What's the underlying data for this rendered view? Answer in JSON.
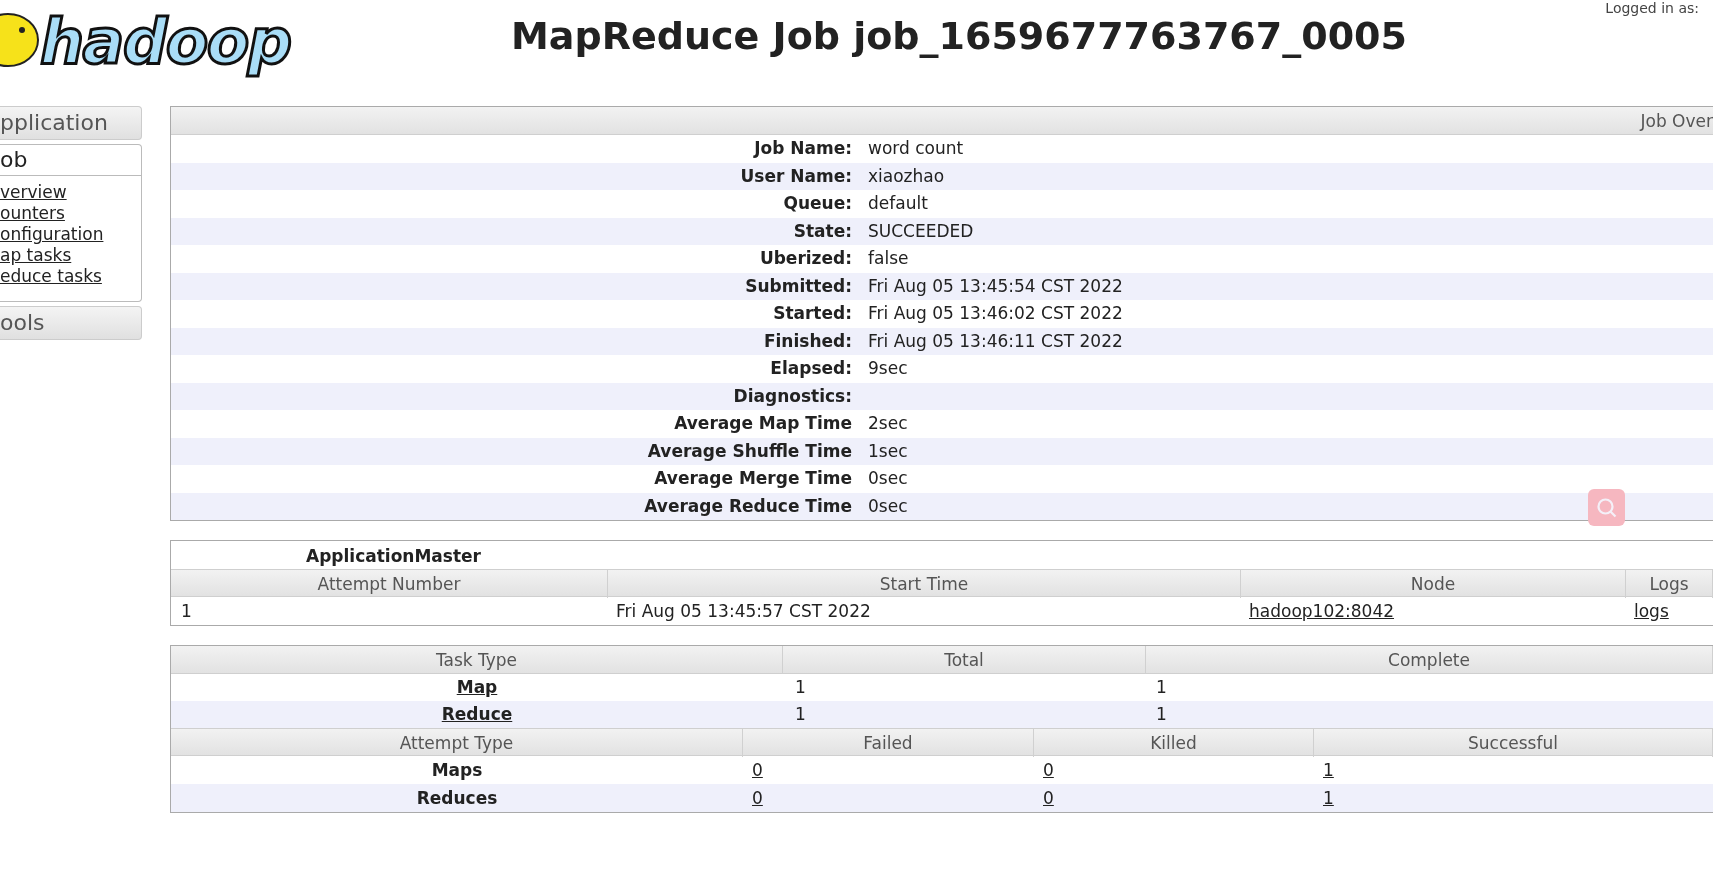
{
  "header": {
    "logo_text": "hadoop",
    "title": "MapReduce Job job_1659677763767_0005",
    "login": "Logged in as:"
  },
  "sidebar": {
    "sections": [
      {
        "title": "pplication"
      },
      {
        "title": "ob",
        "links": [
          "verview",
          "ounters",
          "onfiguration",
          "ap tasks",
          "educe tasks"
        ]
      },
      {
        "title": "ools"
      }
    ]
  },
  "overview": {
    "header": "Job Over",
    "rows": [
      {
        "label": "Job Name:",
        "value": "word count"
      },
      {
        "label": "User Name:",
        "value": "xiaozhao"
      },
      {
        "label": "Queue:",
        "value": "default"
      },
      {
        "label": "State:",
        "value": "SUCCEEDED"
      },
      {
        "label": "Uberized:",
        "value": "false"
      },
      {
        "label": "Submitted:",
        "value": "Fri Aug 05 13:45:54 CST 2022"
      },
      {
        "label": "Started:",
        "value": "Fri Aug 05 13:46:02 CST 2022"
      },
      {
        "label": "Finished:",
        "value": "Fri Aug 05 13:46:11 CST 2022"
      },
      {
        "label": "Elapsed:",
        "value": "9sec"
      },
      {
        "label": "Diagnostics:",
        "value": ""
      },
      {
        "label": "Average Map Time",
        "value": "2sec"
      },
      {
        "label": "Average Shuffle Time",
        "value": "1sec"
      },
      {
        "label": "Average Merge Time",
        "value": "0sec"
      },
      {
        "label": "Average Reduce Time",
        "value": "0sec"
      }
    ]
  },
  "app_master": {
    "title": "ApplicationMaster",
    "columns": [
      "Attempt Number",
      "Start Time",
      "Node",
      "Logs"
    ],
    "rows": [
      {
        "attempt": "1",
        "start_time": "Fri Aug 05 13:45:57 CST 2022",
        "node": "hadoop102:8042",
        "logs": "logs"
      }
    ]
  },
  "tasks": {
    "columns": [
      "Task Type",
      "Total",
      "Complete"
    ],
    "rows": [
      {
        "type": "Map",
        "total": "1",
        "complete": "1"
      },
      {
        "type": "Reduce",
        "total": "1",
        "complete": "1"
      }
    ]
  },
  "attempts": {
    "columns": [
      "Attempt Type",
      "Failed",
      "Killed",
      "Successful"
    ],
    "rows": [
      {
        "type": "Maps",
        "failed": "0",
        "killed": "0",
        "successful": "1"
      },
      {
        "type": "Reduces",
        "failed": "0",
        "killed": "0",
        "successful": "1"
      }
    ]
  }
}
